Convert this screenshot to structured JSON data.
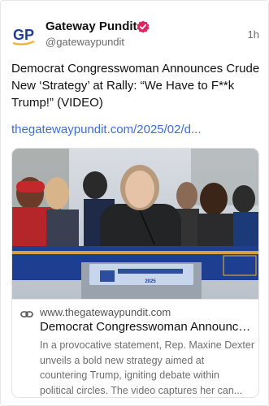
{
  "post": {
    "author_name": "Gateway Pundit",
    "author_handle": "@gatewaypundit",
    "avatar_text": "GP",
    "timestamp": "1h",
    "text": "Democrat Congresswoman Announces Crude New ‘Strategy’ at Rally: “We Have to F**k Trump!” (VIDEO)",
    "link": "thegatewaypundit.com/2025/02/d..."
  },
  "embed": {
    "domain": "www.thegatewaypundit.com",
    "title": "Democrat Congresswoman Announce...",
    "description": "In a provocative statement, Rep. Maxine Dexter unveils a bold new strategy aimed at countering Trump, igniting debate within political circles. The video captures her can...",
    "image": {
      "podium_sign": "2025"
    }
  },
  "colors": {
    "brand_blue": "#1e3f91",
    "brand_gold": "#f2b530",
    "verified_red": "#e0245e",
    "link_blue": "#3b6fd8"
  }
}
